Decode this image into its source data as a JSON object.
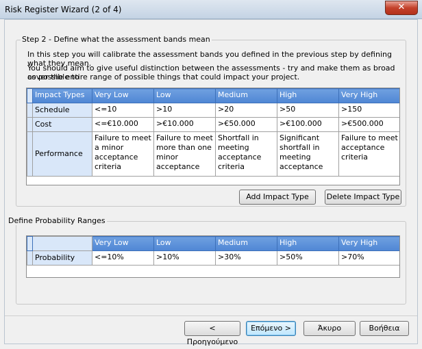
{
  "window": {
    "title": "Risk Register Wizard (2 of 4)",
    "close_glyph": "✕"
  },
  "step": {
    "group_title": "Step 2 - Define what the assessment bands mean",
    "para1": "In this step you will calibrate the assessment bands you defined in the previous step by defining what they mean.",
    "para2a": "You should aim to give useful distinction between the assessments - try and make them as broad as possible to",
    "para2b": "cover the entire range of possible things that could impact your project."
  },
  "impact_table": {
    "headers": [
      "Impact Types",
      "Very Low",
      "Low",
      "Medium",
      "High",
      "Very High"
    ],
    "rows": [
      {
        "label": "Schedule",
        "cells": [
          "<=10",
          ">10",
          ">20",
          ">50",
          ">150"
        ]
      },
      {
        "label": "Cost",
        "cells": [
          "<=€10.000",
          ">€10.000",
          ">€50.000",
          ">€100.000",
          ">€500.000"
        ]
      },
      {
        "label": "Performance",
        "cells": [
          "Failure to meet a minor acceptance criteria",
          "Failure to meet more than one minor acceptance",
          "Shortfall in meeting acceptance criteria",
          "Significant shortfall in meeting acceptance",
          "Failure to meet acceptance criteria"
        ]
      }
    ]
  },
  "buttons": {
    "add_impact": "Add Impact Type",
    "delete_impact": "Delete Impact Type",
    "previous": "< Προηγούμενο",
    "next": "Επόμενο >",
    "cancel": "Άκυρο",
    "help": "Βοήθεια"
  },
  "probability": {
    "group_title": "Define Probability Ranges",
    "headers": [
      "",
      "Very Low",
      "Low",
      "Medium",
      "High",
      "Very High"
    ],
    "row": {
      "label": "Probability",
      "cells": [
        "<=10%",
        ">10%",
        ">30%",
        ">50%",
        ">70%"
      ]
    }
  }
}
